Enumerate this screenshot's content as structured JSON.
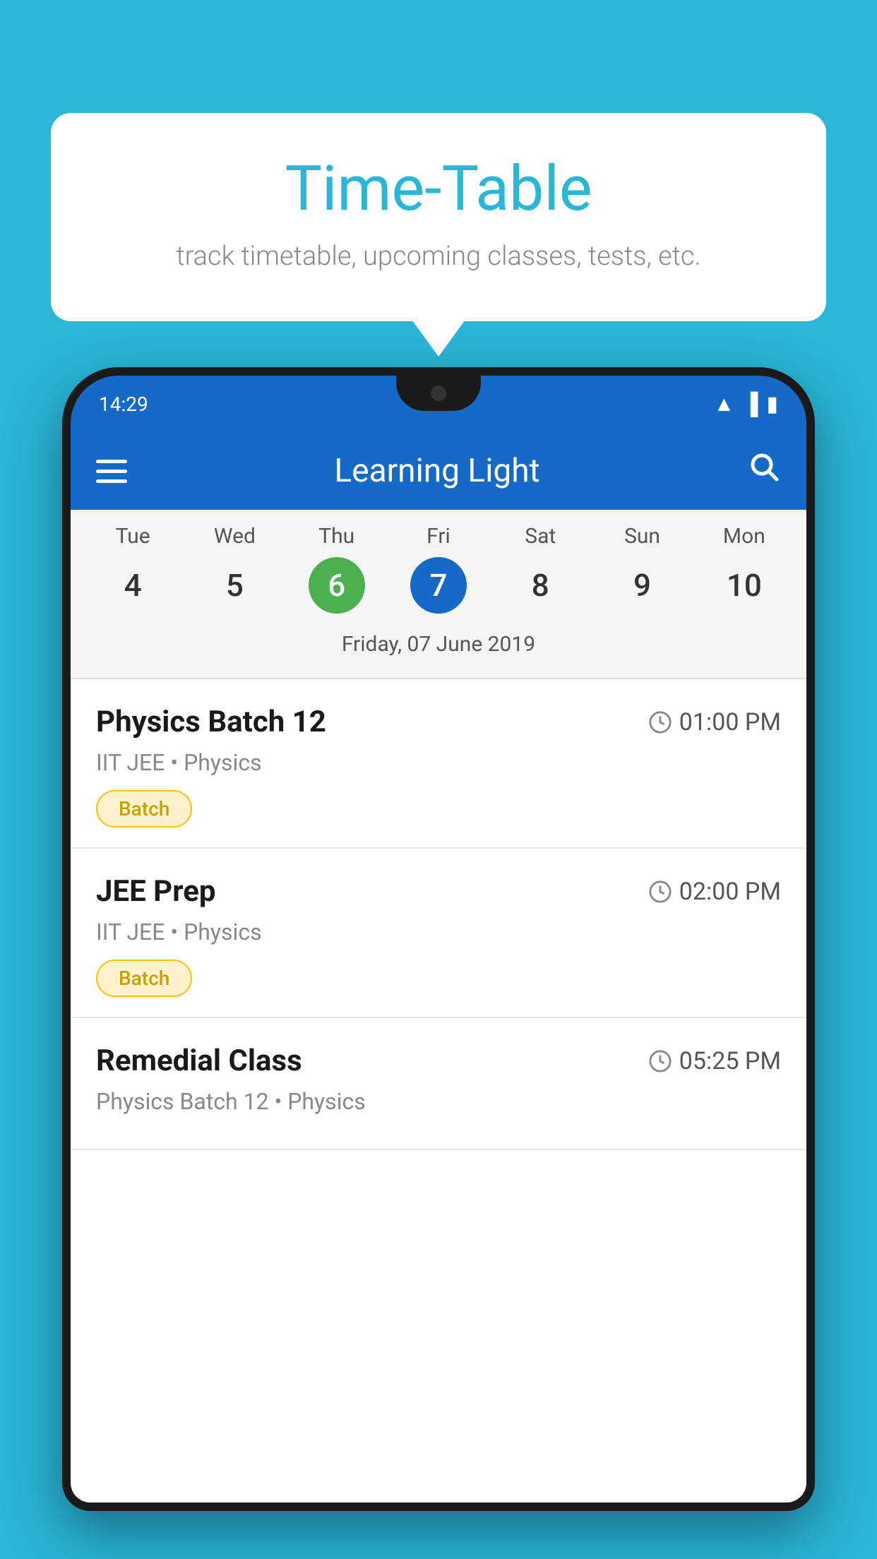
{
  "background_color": "#29b6d8",
  "speech_bubble": {
    "title": "Time-Table",
    "subtitle": "track timetable, upcoming classes, tests, etc."
  },
  "phone": {
    "status_bar": {
      "time": "14:29",
      "icons": [
        "wifi",
        "signal",
        "battery"
      ]
    },
    "app_header": {
      "title": "Learning Light",
      "menu_label": "menu",
      "search_label": "search"
    },
    "calendar": {
      "days": [
        {
          "name": "Tue",
          "num": "4",
          "state": "normal"
        },
        {
          "name": "Wed",
          "num": "5",
          "state": "normal"
        },
        {
          "name": "Thu",
          "num": "6",
          "state": "today"
        },
        {
          "name": "Fri",
          "num": "7",
          "state": "selected"
        },
        {
          "name": "Sat",
          "num": "8",
          "state": "normal"
        },
        {
          "name": "Sun",
          "num": "9",
          "state": "normal"
        },
        {
          "name": "Mon",
          "num": "10",
          "state": "normal"
        }
      ],
      "selected_date_label": "Friday, 07 June 2019"
    },
    "schedule_items": [
      {
        "title": "Physics Batch 12",
        "time": "01:00 PM",
        "subtitle": "IIT JEE • Physics",
        "badge": "Batch"
      },
      {
        "title": "JEE Prep",
        "time": "02:00 PM",
        "subtitle": "IIT JEE • Physics",
        "badge": "Batch"
      },
      {
        "title": "Remedial Class",
        "time": "05:25 PM",
        "subtitle": "Physics Batch 12 • Physics",
        "badge": null
      }
    ]
  }
}
